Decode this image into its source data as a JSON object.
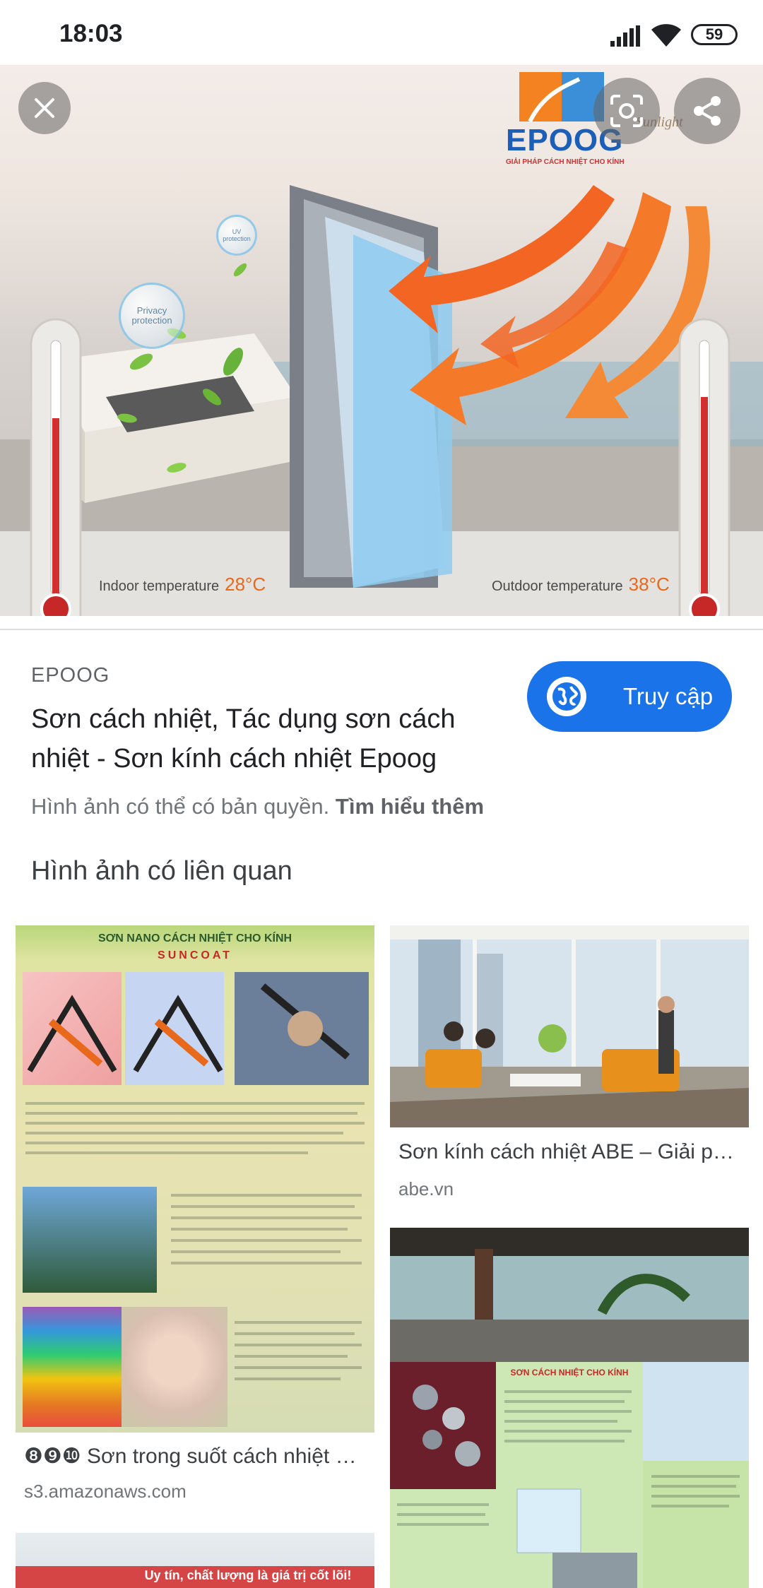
{
  "status_bar": {
    "time": "18:03",
    "battery": "59",
    "icons": [
      "signal-icon",
      "wifi-icon",
      "battery-icon"
    ]
  },
  "hero": {
    "brand": "EPOOG",
    "brand_tagline": "GIẢI PHÁP CÁCH NHIỆT CHO KÍNH",
    "watermark": "Sunlight",
    "bubble_privacy": "Privacy protection",
    "bubble_uv": "UV protection",
    "indoor_label": "Indoor temperature",
    "indoor_value": "28°C",
    "outdoor_label": "Outdoor temperature",
    "outdoor_value": "38°C",
    "buttons": [
      "close-icon",
      "lens-icon",
      "share-icon"
    ]
  },
  "result": {
    "source": "EPOOG",
    "title": "Sơn cách nhiệt, Tác dụng sơn cách nhiệt - Sơn kính cách nhiệt Epoog",
    "visit_label": "Truy cập",
    "copyright_text": "Hình ảnh có thể có bản quyền.",
    "learn_more": "Tìm hiểu thêm"
  },
  "related": {
    "heading": "Hình ảnh có liên quan",
    "items": [
      {
        "caption": "❽❾❿ Sơn trong suốt cách nhiệt …",
        "domain": "s3.amazonaws.com",
        "thumb_title": "SƠN NANO CÁCH NHIỆT CHO KÍNH",
        "thumb_subtitle": "SUNCOAT"
      },
      {
        "caption": "Sơn kính cách nhiệt ABE – Giải p…",
        "domain": "abe.vn"
      },
      {
        "thumb_title": "SƠN CÁCH NHIỆT CHO KÍNH"
      },
      {
        "thumb_text": "Uy tín, chất lượng là giá trị cốt lõi!"
      }
    ]
  },
  "colors": {
    "accent": "#1a73e8",
    "arrow": "#f26522",
    "thermo_red": "#d32f2f"
  }
}
